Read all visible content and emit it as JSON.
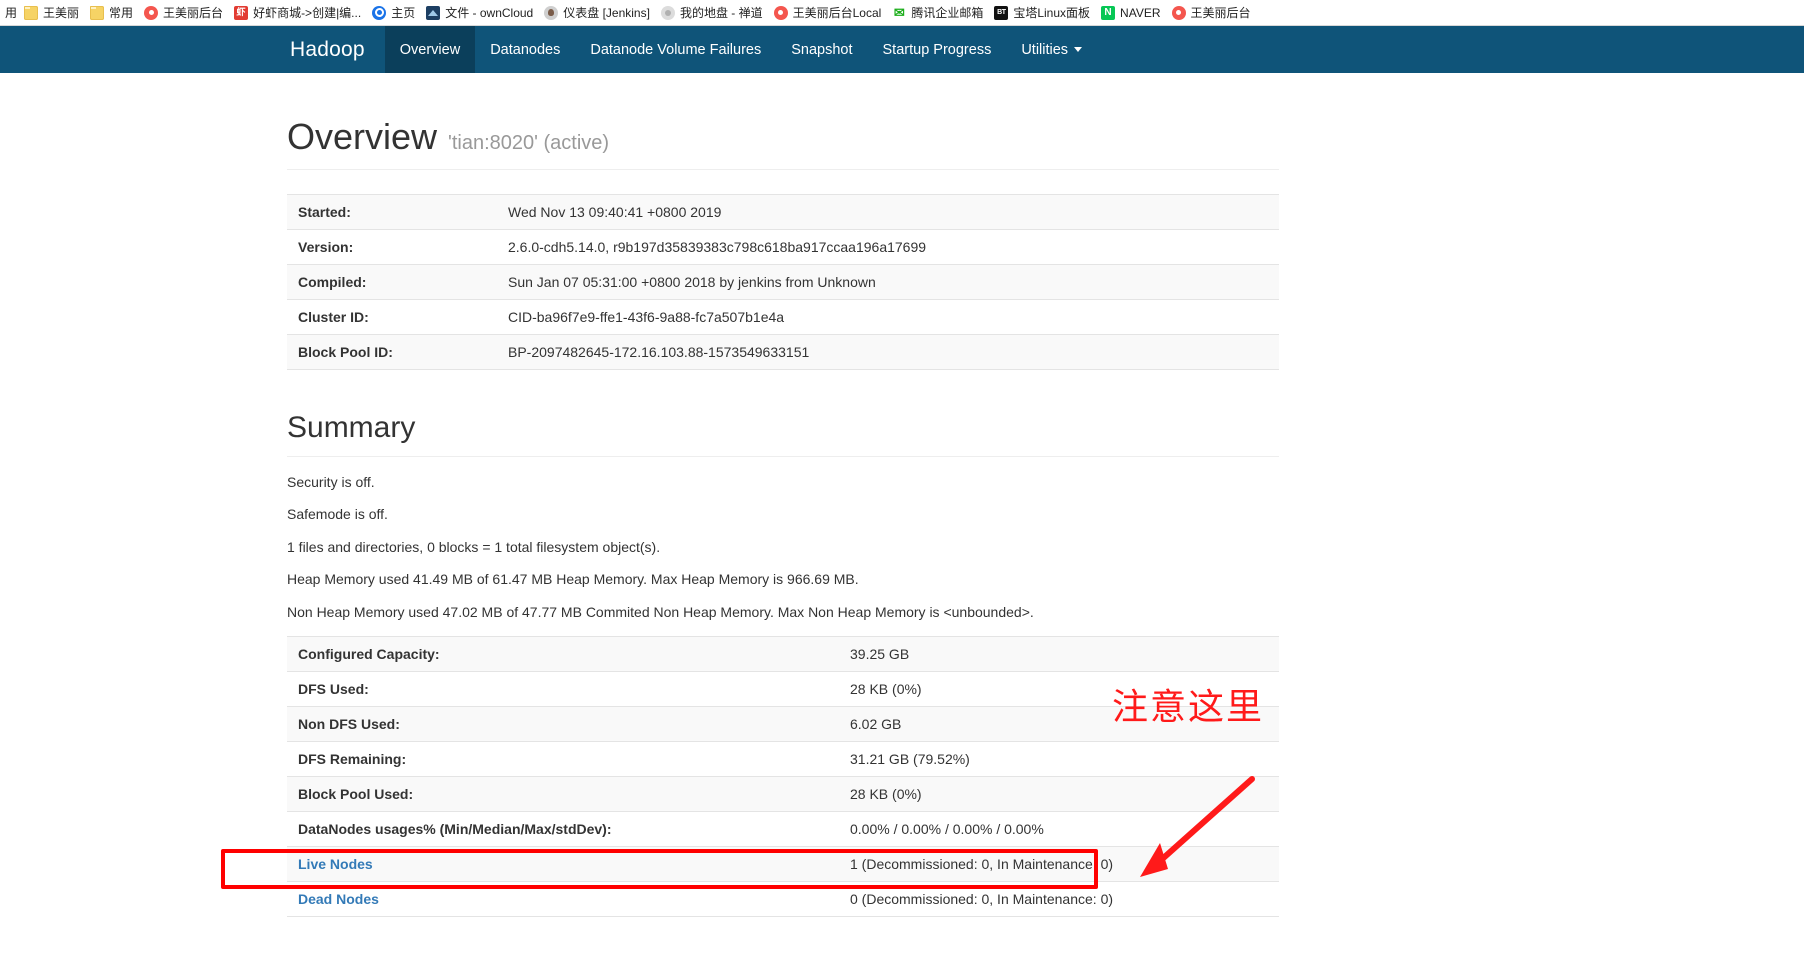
{
  "browser": {
    "bookmarks": [
      {
        "label": "王美丽",
        "icon": "folder-icon",
        "icon_class": "ico-folder",
        "glyph": ""
      },
      {
        "label": "常用",
        "icon": "folder-icon",
        "icon_class": "ico-folder",
        "glyph": ""
      },
      {
        "label": "王美丽后台",
        "icon": "red-circle-favicon",
        "icon_class": "ico-circle-red",
        "glyph": ""
      },
      {
        "label": "好虾商城->创建|编...",
        "icon": "red-square-favicon",
        "icon_class": "ico-red-sq",
        "glyph": "虾"
      },
      {
        "label": "主页",
        "icon": "gear-icon",
        "icon_class": "ico-gear",
        "glyph": ""
      },
      {
        "label": "文件 - ownCloud",
        "icon": "owncloud-icon",
        "icon_class": "ico-cloud",
        "glyph": ""
      },
      {
        "label": "仪表盘 [Jenkins]",
        "icon": "jenkins-icon",
        "icon_class": "ico-jenkins",
        "glyph": ""
      },
      {
        "label": "我的地盘 - 禅道",
        "icon": "zentao-icon",
        "icon_class": "ico-grey",
        "glyph": ""
      },
      {
        "label": "王美丽后台Local",
        "icon": "red-circle-favicon",
        "icon_class": "ico-circle-red",
        "glyph": ""
      },
      {
        "label": "腾讯企业邮箱",
        "icon": "tencent-mail-icon",
        "icon_class": "ico-x",
        "glyph": "✉"
      },
      {
        "label": "宝塔Linux面板",
        "icon": "bt-panel-icon",
        "icon_class": "ico-bt",
        "glyph": "BT"
      },
      {
        "label": "NAVER",
        "icon": "naver-icon",
        "icon_class": "ico-naver",
        "glyph": "N"
      },
      {
        "label": "王美丽后台",
        "icon": "red-circle-favicon",
        "icon_class": "ico-circle-red",
        "glyph": ""
      }
    ],
    "overflow_label": "用"
  },
  "navbar": {
    "brand": "Hadoop",
    "items": [
      {
        "label": "Overview",
        "active": true
      },
      {
        "label": "Datanodes",
        "active": false
      },
      {
        "label": "Datanode Volume Failures",
        "active": false
      },
      {
        "label": "Snapshot",
        "active": false
      },
      {
        "label": "Startup Progress",
        "active": false
      },
      {
        "label": "Utilities",
        "active": false,
        "caret": true
      }
    ]
  },
  "page": {
    "title": "Overview",
    "subtitle": "'tian:8020' (active)"
  },
  "info_table": {
    "rows": [
      {
        "key": "Started:",
        "value": "Wed Nov 13 09:40:41 +0800 2019"
      },
      {
        "key": "Version:",
        "value": "2.6.0-cdh5.14.0, r9b197d35839383c798c618ba917ccaa196a17699"
      },
      {
        "key": "Compiled:",
        "value": "Sun Jan 07 05:31:00 +0800 2018 by jenkins from Unknown"
      },
      {
        "key": "Cluster ID:",
        "value": "CID-ba96f7e9-ffe1-43f6-9a88-fc7a507b1e4a"
      },
      {
        "key": "Block Pool ID:",
        "value": "BP-2097482645-172.16.103.88-1573549633151"
      }
    ]
  },
  "summary": {
    "heading": "Summary",
    "lines": [
      "Security is off.",
      "Safemode is off.",
      "1 files and directories, 0 blocks = 1 total filesystem object(s).",
      "Heap Memory used 41.49 MB of 61.47 MB Heap Memory. Max Heap Memory is 966.69 MB.",
      "Non Heap Memory used 47.02 MB of 47.77 MB Commited Non Heap Memory. Max Non Heap Memory is <unbounded>."
    ]
  },
  "capacity_table": {
    "rows": [
      {
        "key": "Configured Capacity:",
        "value": "39.25 GB",
        "link": false
      },
      {
        "key": "DFS Used:",
        "value": "28 KB (0%)",
        "link": false
      },
      {
        "key": "Non DFS Used:",
        "value": "6.02 GB",
        "link": false
      },
      {
        "key": "DFS Remaining:",
        "value": "31.21 GB (79.52%)",
        "link": false
      },
      {
        "key": "Block Pool Used:",
        "value": "28 KB (0%)",
        "link": false
      },
      {
        "key": "DataNodes usages% (Min/Median/Max/stdDev):",
        "value": "0.00% / 0.00% / 0.00% / 0.00%",
        "link": false
      },
      {
        "key": "Live Nodes",
        "value": "1 (Decommissioned: 0, In Maintenance: 0)",
        "link": true
      },
      {
        "key": "Dead Nodes",
        "value": "0 (Decommissioned: 0, In Maintenance: 0)",
        "link": true
      }
    ]
  },
  "annotation": {
    "text": "注意这里",
    "color": "#ff1a1a"
  }
}
